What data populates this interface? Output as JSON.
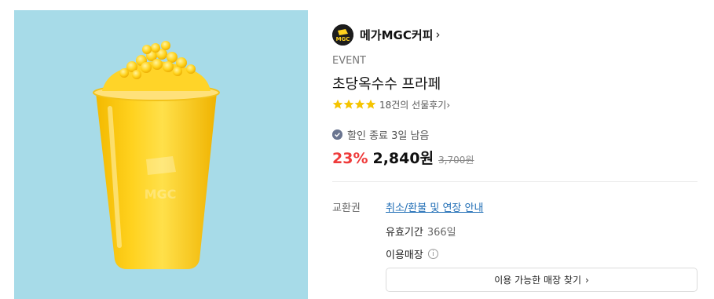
{
  "brand": {
    "name": "메가MGC커피",
    "chevron": "›",
    "logo_text": "MGC"
  },
  "product": {
    "event_label": "EVENT",
    "title": "초당옥수수 프라페",
    "stars": 4,
    "review_text": "18건의 선물후기",
    "review_chevron": "›",
    "sale_end_text": "할인 종료 3일 남음",
    "discount": "23%",
    "sale_price": "2,840원",
    "original_price": "3,700원"
  },
  "details": {
    "exchange_label": "교환권",
    "refund_link": "취소/환불 및 연장 안내",
    "validity_label": "유효기간",
    "validity_value": "366일",
    "store_label": "이용매장",
    "info_icon": "i",
    "find_store_label": "이용 가능한 매장 찾기",
    "find_store_chevron": "›"
  },
  "colors": {
    "image_bg": "#a7dbe8",
    "discount": "#ef3b3b",
    "link": "#1f6db5",
    "star": "#f5c400"
  }
}
